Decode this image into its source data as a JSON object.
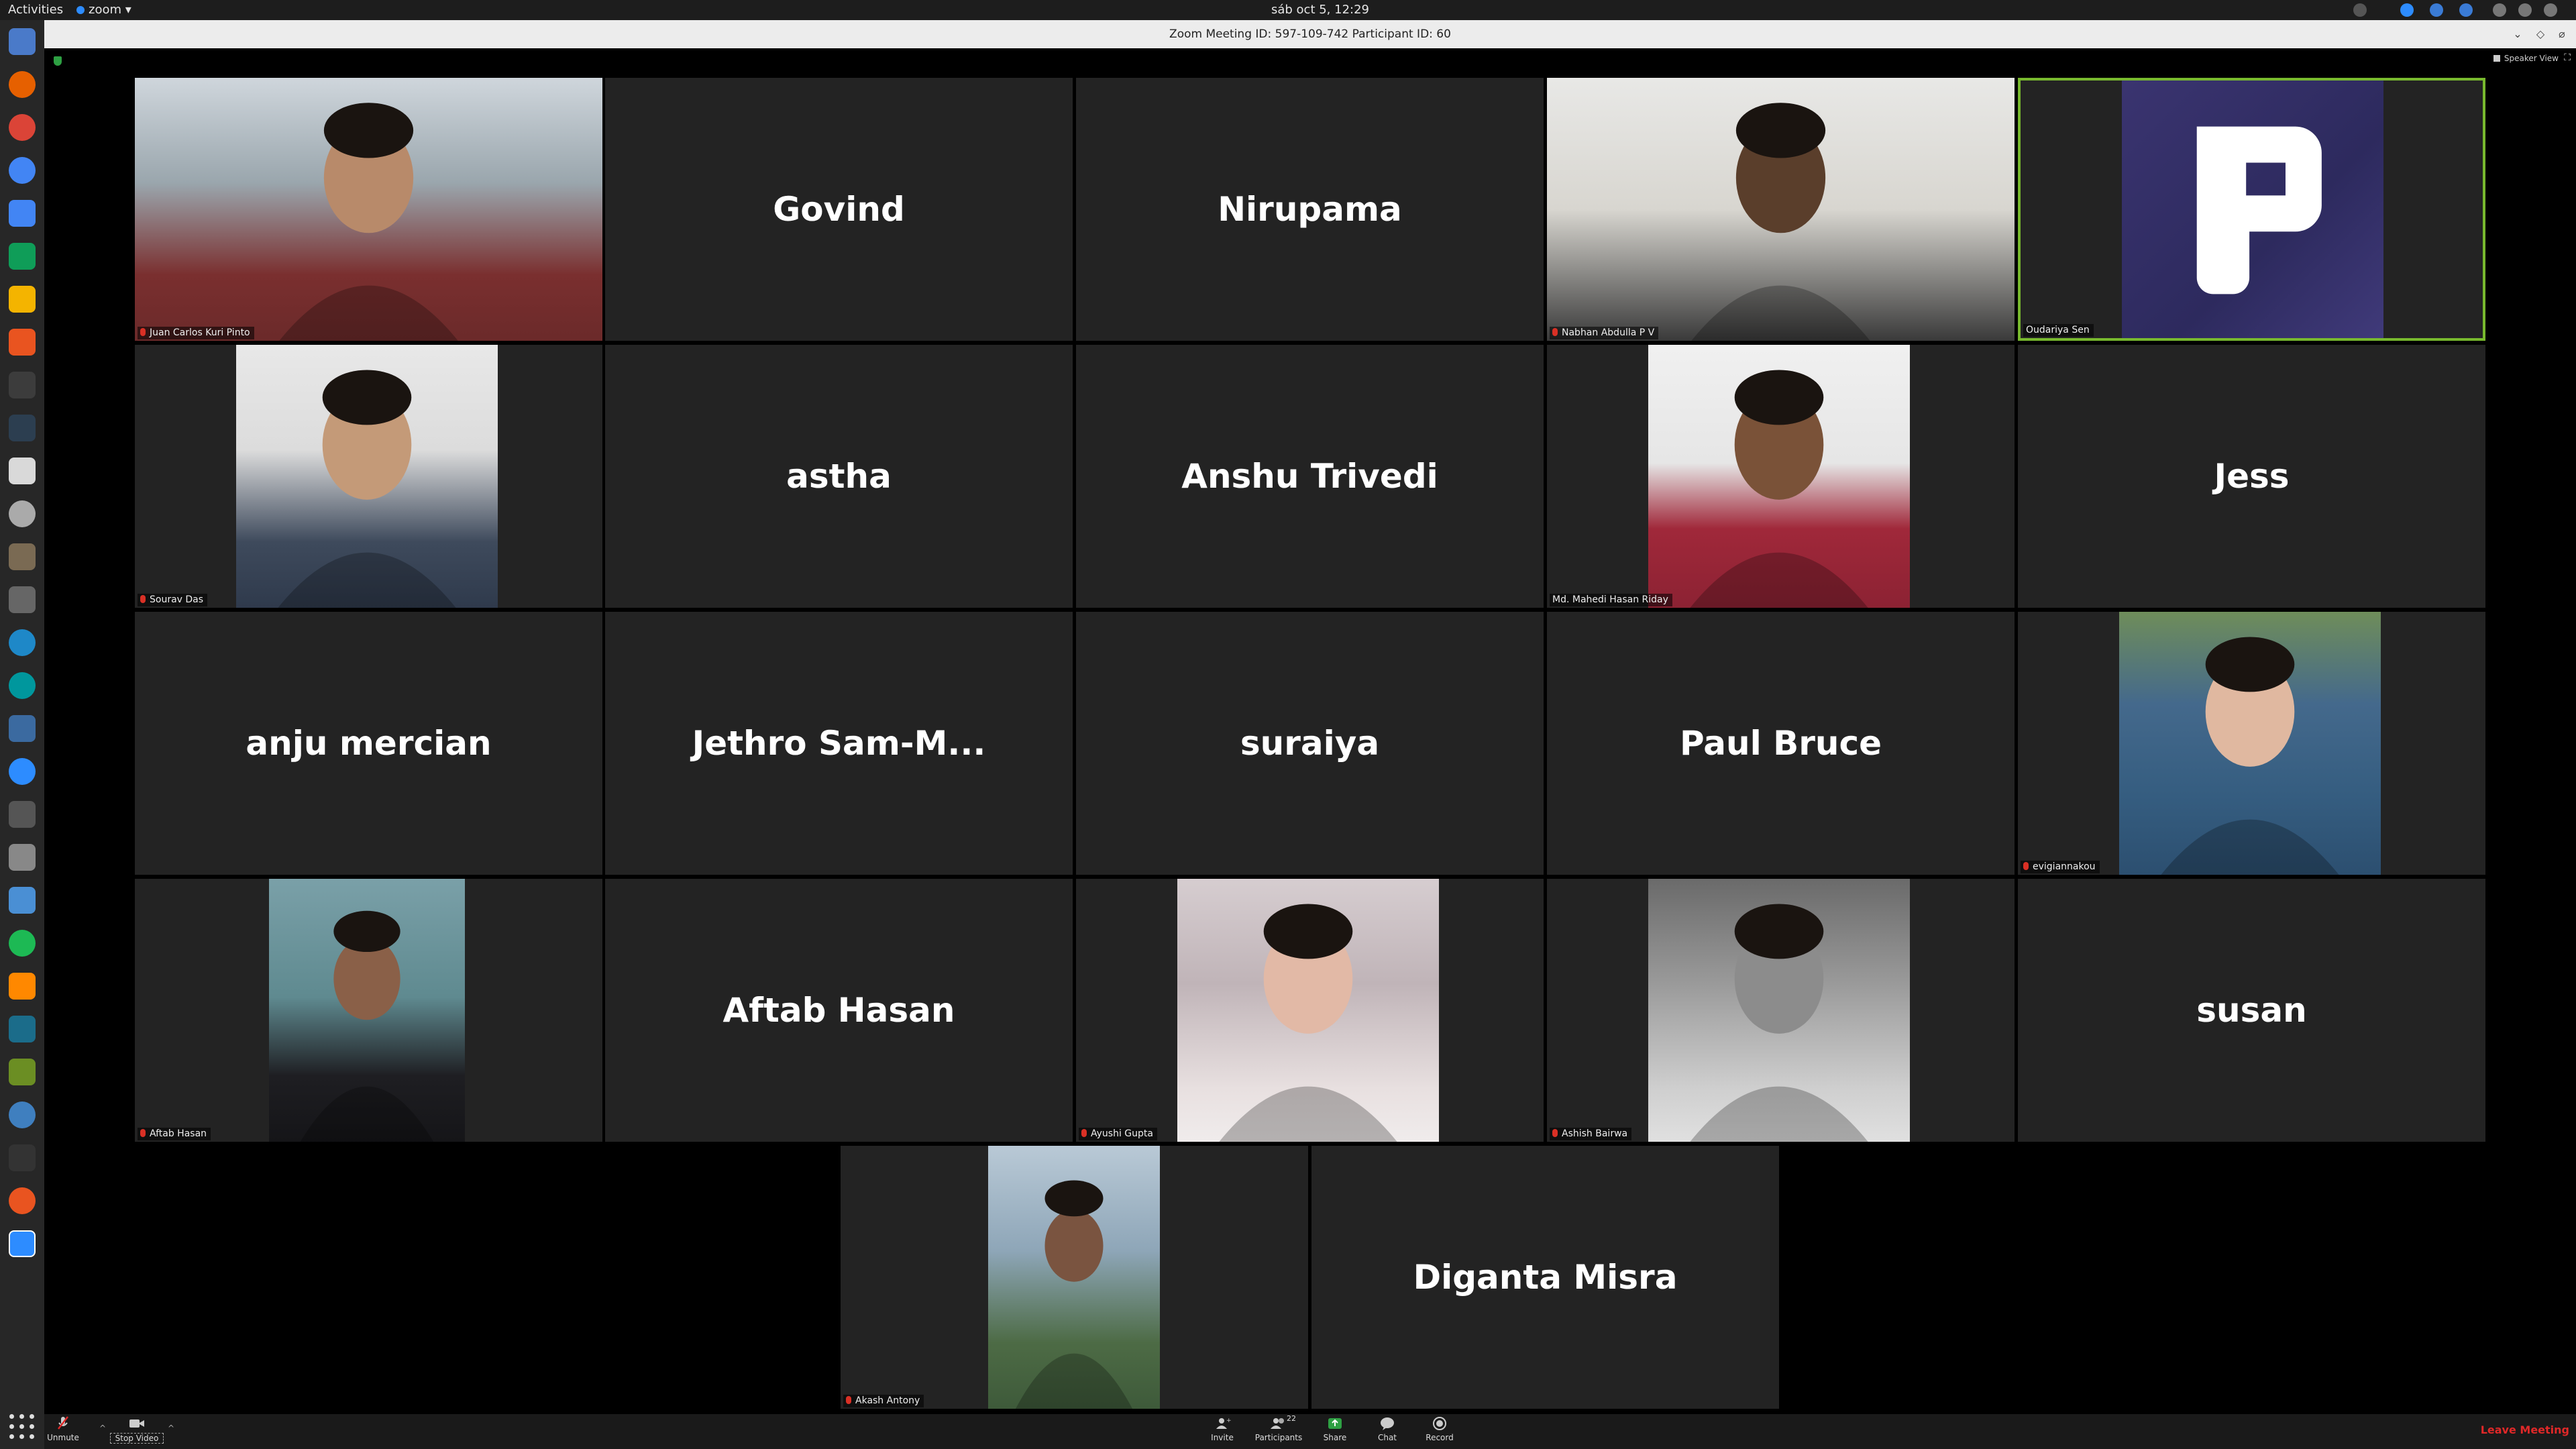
{
  "topbar": {
    "activities": "Activities",
    "app_name": "zoom ▾",
    "clock": "sáb oct  5, 12:29"
  },
  "window": {
    "title": "Zoom Meeting ID: 597-109-742 Participant ID: 60",
    "speaker_view": "Speaker View"
  },
  "tiles": [
    {
      "big": "",
      "label": "Juan Carlos Kuri Pinto",
      "video": true,
      "muted": true,
      "avatar": "man-red-shirt"
    },
    {
      "big": "Govind",
      "label": "",
      "video": false
    },
    {
      "big": "Nirupama",
      "label": "",
      "video": false
    },
    {
      "big": "",
      "label": "Nabhan Abdulla P V",
      "video": true,
      "muted": true,
      "avatar": "man-glasses-dark"
    },
    {
      "big": "",
      "label": "Oudariya Sen",
      "video": true,
      "muted": false,
      "avatar": "p-logo",
      "active": true
    },
    {
      "big": "",
      "label": "Sourav Das",
      "video": true,
      "muted": true,
      "avatar": "man-backpack"
    },
    {
      "big": "astha",
      "label": "",
      "video": false
    },
    {
      "big": "Anshu Trivedi",
      "label": "",
      "video": false
    },
    {
      "big": "",
      "label": "Md. Mahedi Hasan Riday",
      "video": true,
      "muted": false,
      "avatar": "man-red-kurta"
    },
    {
      "big": "Jess",
      "label": "",
      "video": false
    },
    {
      "big": "anju mercian",
      "label": "",
      "video": false
    },
    {
      "big": "Jethro Sam-M...",
      "label": "",
      "video": false
    },
    {
      "big": "suraiya",
      "label": "",
      "video": false
    },
    {
      "big": "Paul Bruce",
      "label": "",
      "video": false
    },
    {
      "big": "",
      "label": "evigiannakou",
      "video": true,
      "muted": true,
      "avatar": "woman-sunglasses-lake"
    },
    {
      "big": "",
      "label": "Aftab Hasan",
      "video": true,
      "muted": true,
      "avatar": "man-glasses-room"
    },
    {
      "big": "Aftab Hasan",
      "label": "",
      "video": false
    },
    {
      "big": "",
      "label": "Ayushi Gupta",
      "video": true,
      "muted": true,
      "avatar": "woman-portrait"
    },
    {
      "big": "",
      "label": "Ashish Bairwa",
      "video": true,
      "muted": true,
      "avatar": "man-bw-hand"
    },
    {
      "big": "susan",
      "label": "",
      "video": false
    },
    {
      "big": "",
      "label": "Akash Antony",
      "video": true,
      "muted": true,
      "avatar": "man-mountains"
    },
    {
      "big": "Diganta Misra",
      "label": "",
      "video": false
    }
  ],
  "toolbar": {
    "unmute": "Unmute",
    "stop_video": "Stop Video",
    "invite": "Invite",
    "participants": "Participants",
    "participant_count": "22",
    "share": "Share",
    "chat": "Chat",
    "record": "Record",
    "leave": "Leave Meeting"
  },
  "dock": {
    "icons": [
      "files",
      "firefox",
      "chrome",
      "chromium",
      "docs",
      "sheets",
      "slides",
      "software-center",
      "tools",
      "terminal",
      "text-editor",
      "disc",
      "gimp",
      "video",
      "browser",
      "arduino",
      "vscode",
      "zoom",
      "calculator",
      "keyboard",
      "vmware",
      "spotify",
      "vlc",
      "pycharm",
      "android",
      "earth",
      "monitor",
      "ubuntu",
      "zoom-active"
    ],
    "show_apps_icon": "grid-icon"
  },
  "colors": {
    "tile_bg": "#232323",
    "active_border": "#78b92e",
    "leave_red": "#e02828",
    "mute_red": "#d93025"
  }
}
